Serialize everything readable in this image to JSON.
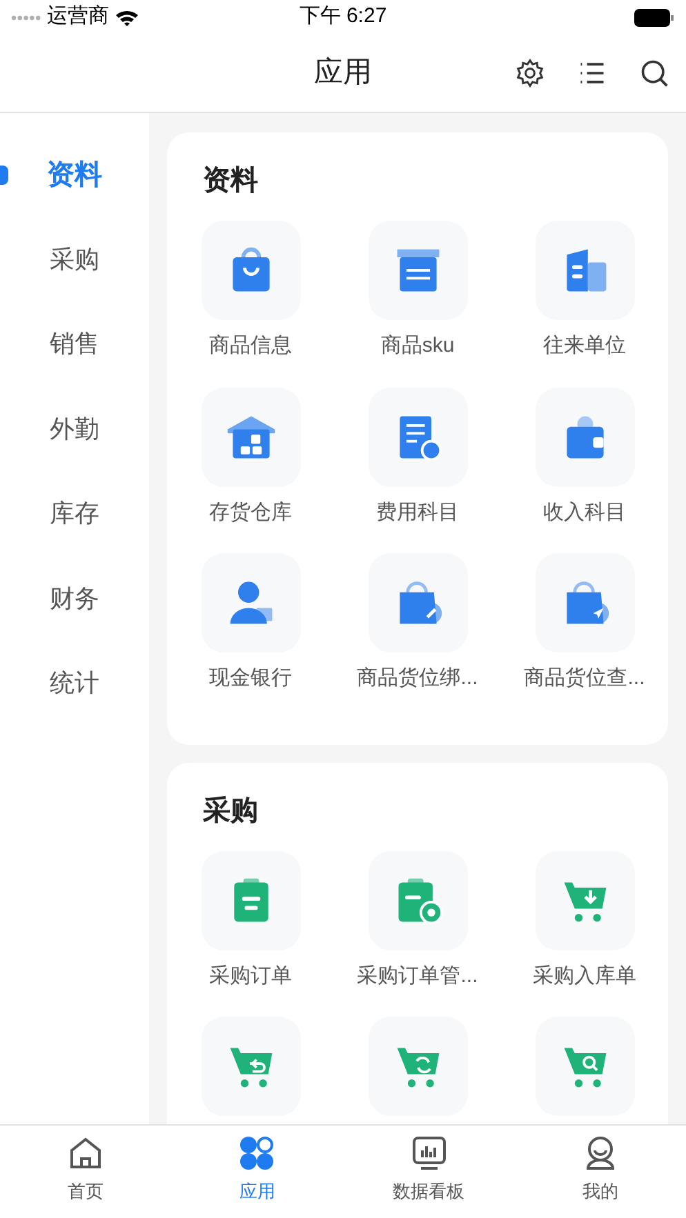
{
  "status_bar": {
    "carrier": "运营商",
    "time": "下午 6:27"
  },
  "header": {
    "title": "应用"
  },
  "sidebar": {
    "items": [
      {
        "label": "资料",
        "selected": true
      },
      {
        "label": "采购",
        "selected": false
      },
      {
        "label": "销售",
        "selected": false
      },
      {
        "label": "外勤",
        "selected": false
      },
      {
        "label": "库存",
        "selected": false
      },
      {
        "label": "财务",
        "selected": false
      },
      {
        "label": "统计",
        "selected": false
      }
    ]
  },
  "sections": [
    {
      "title": "资料",
      "color": "#2f80ed",
      "items": [
        {
          "label": "商品信息"
        },
        {
          "label": "商品sku"
        },
        {
          "label": "往来单位"
        },
        {
          "label": "存货仓库"
        },
        {
          "label": "费用科目"
        },
        {
          "label": "收入科目"
        },
        {
          "label": "现金银行"
        },
        {
          "label": "商品货位绑..."
        },
        {
          "label": "商品货位查..."
        }
      ]
    },
    {
      "title": "采购",
      "color": "#1fb37a",
      "items": [
        {
          "label": "采购订单"
        },
        {
          "label": "采购订单管..."
        },
        {
          "label": "采购入库单"
        },
        {
          "kind": "tile"
        },
        {
          "kind": "tile"
        },
        {
          "kind": "tile"
        }
      ]
    }
  ],
  "tab_bar": [
    {
      "label": "首页",
      "selected": false
    },
    {
      "label": "应用",
      "selected": true
    },
    {
      "label": "数据看板",
      "selected": false
    },
    {
      "label": "我的",
      "selected": false
    }
  ]
}
